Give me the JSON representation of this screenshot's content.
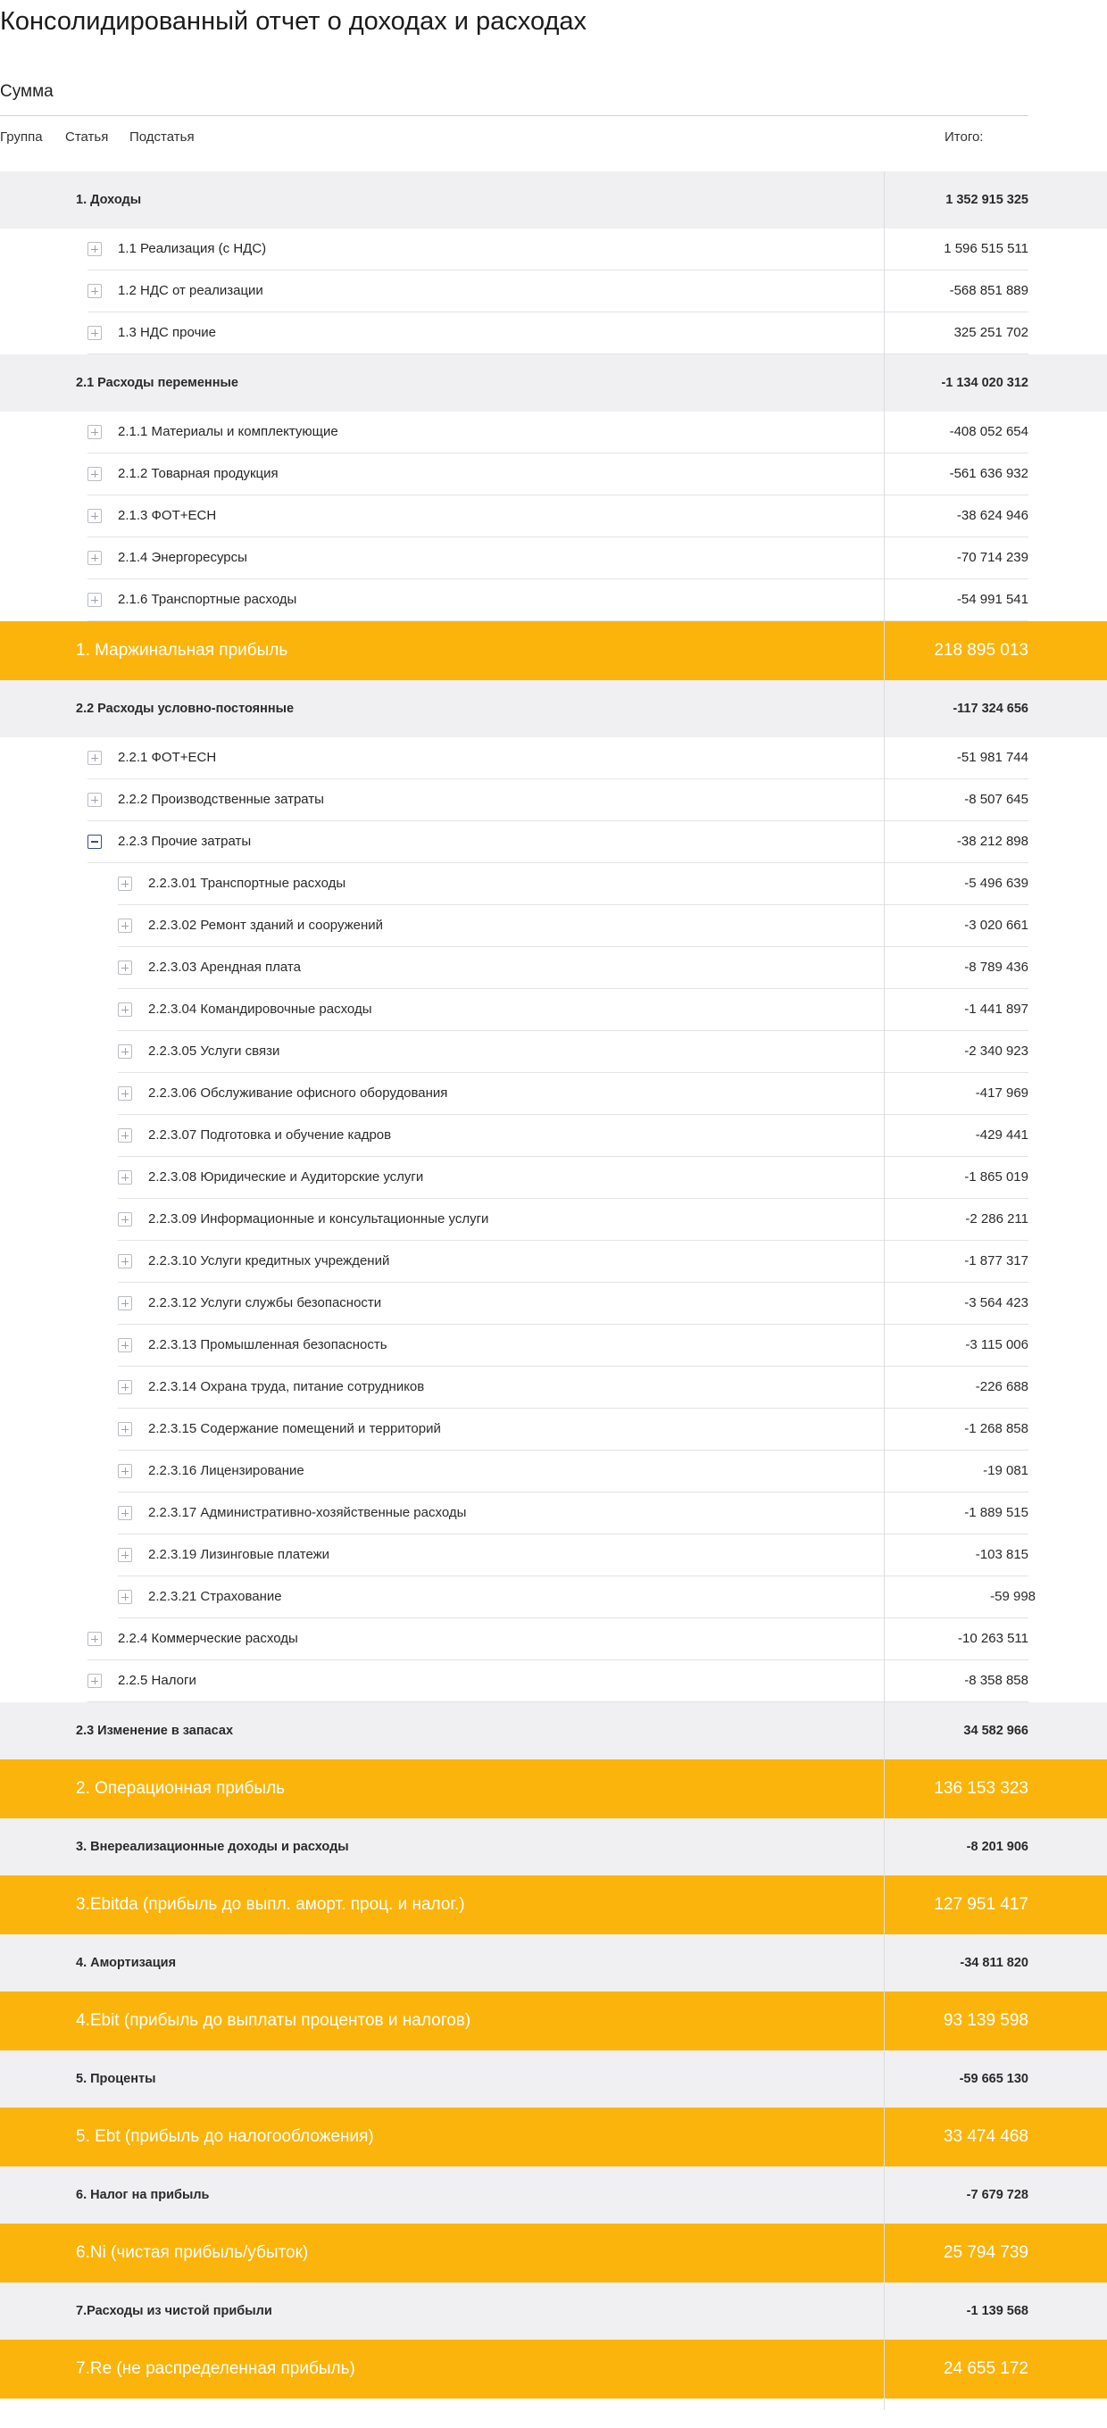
{
  "title": "Консолидированный отчет о доходах и расходах",
  "measure": "Сумма",
  "header": {
    "group": "Группа",
    "article": "Статья",
    "subarticle": "Подстатья",
    "total": "Итого:"
  },
  "rows": [
    {
      "type": "group",
      "label": "1. Доходы",
      "value": "1 352 915 325"
    },
    {
      "type": "item",
      "label": "1.1 Реализация (с НДС)",
      "value": "1 596 515 511"
    },
    {
      "type": "item",
      "label": "1.2 НДС от реализации",
      "value": "-568 851 889"
    },
    {
      "type": "item",
      "label": "1.3 НДС прочие",
      "value": "325 251 702"
    },
    {
      "type": "group",
      "label": "2.1  Расходы переменные",
      "value": "-1 134 020 312"
    },
    {
      "type": "item",
      "label": "2.1.1 Материалы и комплектующие",
      "value": "-408 052 654"
    },
    {
      "type": "item",
      "label": "2.1.2 Товарная продукция",
      "value": "-561 636 932"
    },
    {
      "type": "item",
      "label": "2.1.3 ФОТ+ЕСН",
      "value": "-38 624 946"
    },
    {
      "type": "item",
      "label": "2.1.4 Энергоресурсы",
      "value": "-70 714 239"
    },
    {
      "type": "item",
      "label": "2.1.6 Транспортные расходы",
      "value": "-54 991 541"
    },
    {
      "type": "total",
      "label": "1. Маржинальная прибыль",
      "value": "218 895 013"
    },
    {
      "type": "group",
      "label": "2.2  Расходы условно-постоянные",
      "value": "-117 324 656"
    },
    {
      "type": "item",
      "label": "2.2.1 ФОТ+ЕСН",
      "value": "-51 981 744"
    },
    {
      "type": "item",
      "label": "2.2.2 Производственные затраты",
      "value": "-8 507 645"
    },
    {
      "type": "item",
      "label": "2.2.3 Прочие затраты",
      "value": "-38 212 898",
      "expanded": true
    },
    {
      "type": "sub",
      "label": "2.2.3.01 Транспортные расходы",
      "value": "-5 496 639"
    },
    {
      "type": "sub",
      "label": "2.2.3.02 Ремонт зданий и сооружений",
      "value": "-3 020 661"
    },
    {
      "type": "sub",
      "label": "2.2.3.03 Арендная плата",
      "value": "-8 789 436"
    },
    {
      "type": "sub",
      "label": "2.2.3.04 Командировочные расходы",
      "value": "-1 441 897"
    },
    {
      "type": "sub",
      "label": "2.2.3.05 Услуги связи",
      "value": "-2 340 923"
    },
    {
      "type": "sub",
      "label": "2.2.3.06 Обслуживание офисного оборудования",
      "value": "-417 969"
    },
    {
      "type": "sub",
      "label": "2.2.3.07 Подготовка и обучение кадров",
      "value": "-429 441"
    },
    {
      "type": "sub",
      "label": "2.2.3.08 Юридические и Аудиторские услуги",
      "value": "-1 865 019"
    },
    {
      "type": "sub",
      "label": "2.2.3.09 Информационные и консультационные услуги",
      "value": "-2 286 211"
    },
    {
      "type": "sub",
      "label": "2.2.3.10 Услуги кредитных учреждений",
      "value": "-1 877 317"
    },
    {
      "type": "sub",
      "label": "2.2.3.12 Услуги службы безопасности",
      "value": "-3 564 423"
    },
    {
      "type": "sub",
      "label": "2.2.3.13 Промышленная безопасность",
      "value": "-3 115 006"
    },
    {
      "type": "sub",
      "label": "2.2.3.14  Охрана труда, питание сотрудников",
      "value": "-226 688"
    },
    {
      "type": "sub",
      "label": "2.2.3.15 Содержание помещений и территорий",
      "value": "-1 268 858"
    },
    {
      "type": "sub",
      "label": "2.2.3.16 Лицензирование",
      "value": "-19 081"
    },
    {
      "type": "sub",
      "label": "2.2.3.17 Административно-хозяйственные расходы",
      "value": "-1 889 515"
    },
    {
      "type": "sub",
      "label": "2.2.3.19 Лизинговые платежи",
      "value": "-103 815"
    },
    {
      "type": "sub",
      "label": "2.2.3.21  Страхование",
      "value": "-59 998",
      "shift": true
    },
    {
      "type": "item",
      "label": "2.2.4 Коммерческие расходы",
      "value": "-10 263 511"
    },
    {
      "type": "item",
      "label": "2.2.5 Налоги",
      "value": "-8 358 858"
    },
    {
      "type": "group",
      "label": "2.3  Изменение в запасах",
      "value": "34 582 966"
    },
    {
      "type": "total",
      "label": "2. Операционная прибыль",
      "value": "136 153 323"
    },
    {
      "type": "group",
      "label": "3. Внереализационные доходы и расходы",
      "value": "-8 201 906"
    },
    {
      "type": "total",
      "label": "3.Ebitda (прибыль до выпл. аморт.  проц. и налог.)",
      "value": "127 951 417"
    },
    {
      "type": "group",
      "label": "4. Амортизация",
      "value": "-34 811 820"
    },
    {
      "type": "total",
      "label": "4.Ebit (прибыль до выплаты процентов и налогов)",
      "value": "93 139 598"
    },
    {
      "type": "group",
      "label": "5. Проценты",
      "value": "-59 665 130"
    },
    {
      "type": "total",
      "label": "5. Ebt (прибыль до налогообложения)",
      "value": "33 474 468"
    },
    {
      "type": "group",
      "label": "6. Налог на прибыль",
      "value": "-7 679 728"
    },
    {
      "type": "total",
      "label": "6.Ni (чистая прибыль/убыток)",
      "value": "25 794 739"
    },
    {
      "type": "group",
      "label": "7.Расходы из чистой прибыли",
      "value": "-1 139 568"
    },
    {
      "type": "total",
      "label": "7.Re (не распределенная прибыль)",
      "value": "24 655 172"
    }
  ]
}
